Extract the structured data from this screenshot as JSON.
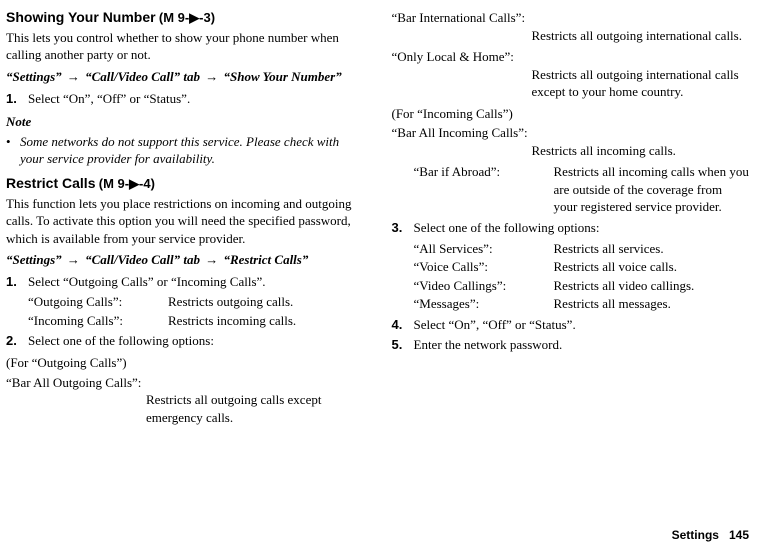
{
  "left": {
    "sec1": {
      "title": "Showing Your Number",
      "menu": "(M 9-▶-3)",
      "desc": "This lets you control whether to show your phone number when calling another party or not.",
      "path": {
        "a": "“Settings”",
        "b": "“Call/Video Call” tab",
        "c": "“Show Your Number”"
      },
      "step1_num": "1.",
      "step1": "Select “On”, “Off” or “Status”.",
      "note_h": "Note",
      "note": "Some networks do not support this service. Please check with your service provider for availability."
    },
    "sec2": {
      "title": "Restrict Calls",
      "menu": "(M 9-▶-4)",
      "desc": "This function lets you place restrictions on incoming and outgoing calls. To activate this option you will need the specified password, which is available from your service provider.",
      "path": {
        "a": "“Settings”",
        "b": "“Call/Video Call” tab",
        "c": "“Restrict Calls”"
      },
      "step1_num": "1.",
      "step1": "Select “Outgoing Calls” or “Incoming Calls”.",
      "p1_l": "“Outgoing Calls”:",
      "p1_v": "Restricts outgoing calls.",
      "p2_l": "“Incoming Calls”:",
      "p2_v": "Restricts incoming calls.",
      "step2_num": "2.",
      "step2": "Select one of the following options:",
      "group_out": "(For “Outgoing Calls”)",
      "s1_l": "“Bar All Outgoing Calls”:",
      "s1_v": "Restricts all outgoing calls except emergency calls."
    }
  },
  "right": {
    "s2_l": "“Bar International Calls”:",
    "s2_v": "Restricts all outgoing international calls.",
    "s3_l": "“Only Local & Home”:",
    "s3_v": "Restricts all outgoing international calls except to your home country.",
    "group_in": "(For “Incoming Calls”)",
    "s4_l": "“Bar All Incoming Calls”:",
    "s4_v": "Restricts all incoming calls.",
    "p5_l": "“Bar if Abroad”:",
    "p5_v": "Restricts all incoming calls when you are outside of the coverage from your registered service provider.",
    "step3_num": "3.",
    "step3": "Select one of the following options:",
    "o1_l": "“All Services”:",
    "o1_v": "Restricts all services.",
    "o2_l": "“Voice Calls”:",
    "o2_v": "Restricts all voice calls.",
    "o3_l": "“Video Callings”:",
    "o3_v": "Restricts all video callings.",
    "o4_l": "“Messages”:",
    "o4_v": "Restricts all messages.",
    "step4_num": "4.",
    "step4": "Select “On”, “Off” or “Status”.",
    "step5_num": "5.",
    "step5": "Enter the network password."
  },
  "footer": "Settings   145"
}
